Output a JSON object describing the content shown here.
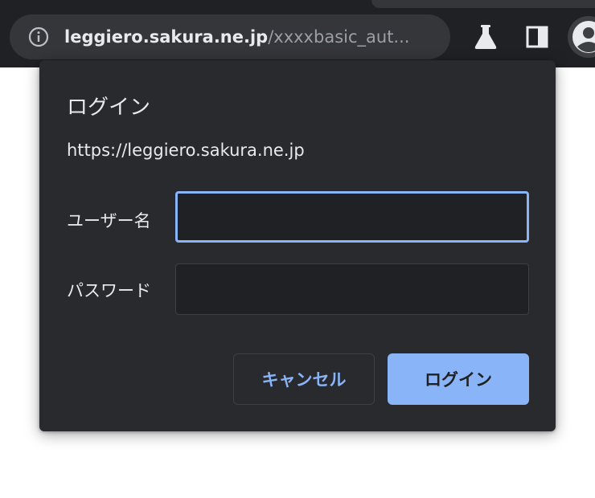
{
  "browser": {
    "url_host": "leggiero.sakura.ne.jp",
    "url_path": "/xxxxbasic_aut...",
    "icons": [
      "info-icon",
      "labs-flask-icon",
      "side-panel-icon",
      "profile-avatar-icon"
    ]
  },
  "dialog": {
    "title": "ログイン",
    "origin": "https://leggiero.sakura.ne.jp",
    "username_label": "ユーザー名",
    "username_value": "",
    "password_label": "パスワード",
    "password_value": "",
    "cancel_label": "キャンセル",
    "login_label": "ログイン"
  },
  "colors": {
    "toolbar": "#202124",
    "omnibox": "#35363a",
    "dialog": "#292a2d",
    "accent": "#8ab4f8"
  }
}
